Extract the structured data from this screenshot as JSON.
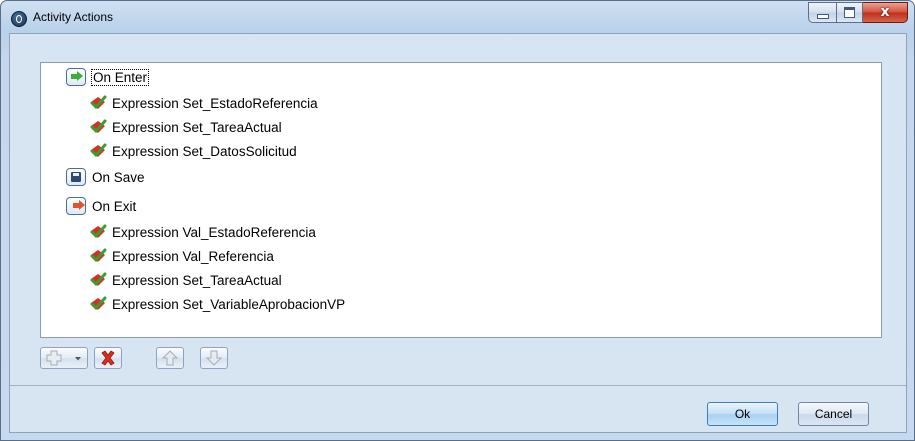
{
  "window": {
    "title": "Activity Actions",
    "close_glyph": "x",
    "icon": "app-icon"
  },
  "tree": {
    "groups": [
      {
        "label": "On Enter",
        "icon": "enter-arrow-icon",
        "expressions": [
          "Expression Set_EstadoReferencia",
          "Expression Set_TareaActual",
          "Expression Set_DatosSolicitud"
        ]
      },
      {
        "label": "On Save",
        "icon": "save-icon",
        "expressions": []
      },
      {
        "label": "On Exit",
        "icon": "exit-arrow-icon",
        "expressions": [
          "Expression Val_EstadoReferencia",
          "Expression Val_Referencia",
          "Expression Set_TareaActual",
          "Expression Set_VariableAprobacionVP"
        ]
      }
    ],
    "expression_icon": "expression-check-icon"
  },
  "toolbar": {
    "add_icon": "add-icon",
    "delete_icon": "delete-icon",
    "up_icon": "move-up-icon",
    "down_icon": "move-down-icon"
  },
  "buttons": {
    "ok": "Ok",
    "cancel": "Cancel"
  },
  "colors": {
    "accent_green": "#3cae38",
    "accent_red": "#e2542a",
    "ok_highlight": "#a9d1f2"
  }
}
